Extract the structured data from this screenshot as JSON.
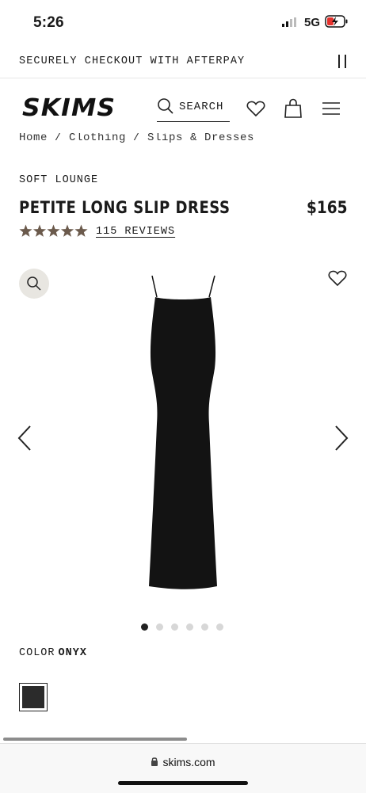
{
  "status_bar": {
    "time": "5:26",
    "network": "5G"
  },
  "promo": {
    "text": "SECURELY CHECKOUT WITH AFTERPAY"
  },
  "header": {
    "logo": "SKIMS",
    "search_label": "SEARCH"
  },
  "breadcrumb": "Home / Clothing / Slips & Dresses",
  "product": {
    "collection": "SOFT LOUNGE",
    "title": "PETITE LONG SLIP DRESS",
    "price": "$165",
    "rating": 5,
    "reviews": "115 REVIEWS",
    "color_label": "COLOR",
    "color_value": "ONYX",
    "swatch_color": "#2b2b2b"
  },
  "gallery": {
    "image_count": 6,
    "active_index": 0
  },
  "browser": {
    "url": "skims.com"
  },
  "colors": {
    "star": "#6b5a4c",
    "zoom_bg": "#e8e6e1"
  },
  "icons": [
    "search-icon",
    "heart-icon",
    "bag-icon",
    "menu-icon",
    "pause-icon",
    "zoom-icon",
    "chevron-left-icon",
    "chevron-right-icon",
    "lock-icon"
  ]
}
